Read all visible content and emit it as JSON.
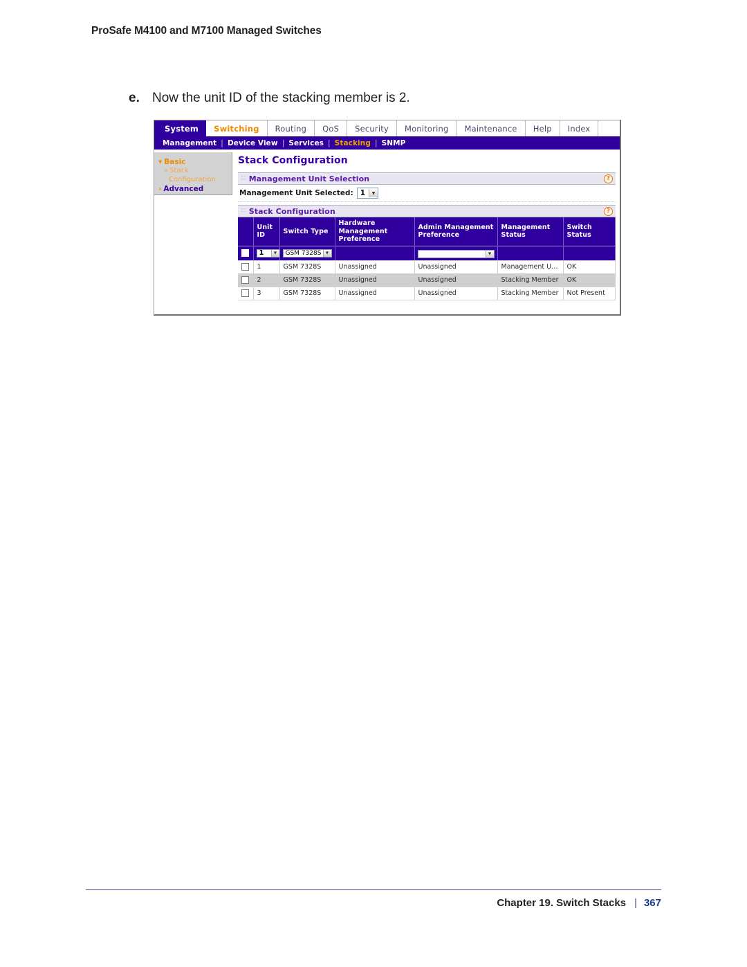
{
  "document": {
    "header": "ProSafe M4100 and M7100 Managed Switches",
    "step": {
      "label": "e.",
      "text": "Now the unit ID of the stacking member is 2."
    },
    "footer": {
      "chapter": "Chapter 19.  Switch Stacks",
      "separator": "|",
      "page": "367"
    }
  },
  "screenshot": {
    "nav": {
      "tabs": [
        {
          "label": "System",
          "state": "active"
        },
        {
          "label": "Switching",
          "state": "hot"
        },
        {
          "label": "Routing",
          "state": "normal"
        },
        {
          "label": "QoS",
          "state": "normal"
        },
        {
          "label": "Security",
          "state": "normal"
        },
        {
          "label": "Monitoring",
          "state": "normal"
        },
        {
          "label": "Maintenance",
          "state": "normal"
        },
        {
          "label": "Help",
          "state": "normal"
        },
        {
          "label": "Index",
          "state": "normal"
        }
      ],
      "subtabs": [
        {
          "label": "Management",
          "state": "normal"
        },
        {
          "label": "Device View",
          "state": "normal"
        },
        {
          "label": "Services",
          "state": "normal"
        },
        {
          "label": "Stacking",
          "state": "hot"
        },
        {
          "label": "SNMP",
          "state": "normal"
        }
      ],
      "subtab_separator": "|"
    },
    "sidebar": {
      "basic": {
        "chevron": "▾",
        "label": "Basic"
      },
      "sub_chevron": "»",
      "sub_line1": "Stack",
      "sub_line2": "Configuration",
      "advanced": {
        "chevron": "›",
        "label": "Advanced"
      }
    },
    "page_title": "Stack Configuration",
    "grip": "∷",
    "help_icon_glyph": "?",
    "panels": {
      "management_unit_selection": {
        "title": "Management Unit Selection",
        "field_label": "Management Unit Selected:",
        "field_value": "1",
        "arrow": "▼"
      },
      "stack_configuration": {
        "title": "Stack Configuration",
        "columns": [
          "Unit ID",
          "Switch Type",
          "Hardware Management Preference",
          "Admin Management Preference",
          "Management Status",
          "Switch Status"
        ],
        "filter_row": {
          "unit_id": "1",
          "switch_type": "GSM 7328S",
          "hardware_management_preference": "",
          "admin_management_preference": "",
          "management_status": "",
          "switch_status": "",
          "arrow": "▼"
        },
        "rows": [
          {
            "unit_id": "1",
            "switch_type": "GSM 7328S",
            "hardware_management_preference": "Unassigned",
            "admin_management_preference": "Unassigned",
            "management_status": "Management Unit",
            "switch_status": "OK",
            "highlight": false
          },
          {
            "unit_id": "2",
            "switch_type": "GSM 7328S",
            "hardware_management_preference": "Unassigned",
            "admin_management_preference": "Unassigned",
            "management_status": "Stacking Member",
            "switch_status": "OK",
            "highlight": true
          },
          {
            "unit_id": "3",
            "switch_type": "GSM 7328S",
            "hardware_management_preference": "Unassigned",
            "admin_management_preference": "Unassigned",
            "management_status": "Stacking Member",
            "switch_status": "Not Present",
            "highlight": false
          }
        ]
      }
    },
    "colors": {
      "purple": "#2f009e",
      "orange": "#f08a00",
      "title_purple": "#3a00a0",
      "panel_head_bg": "#e8e6f0",
      "row_highlight": "#cfcfcf"
    }
  }
}
